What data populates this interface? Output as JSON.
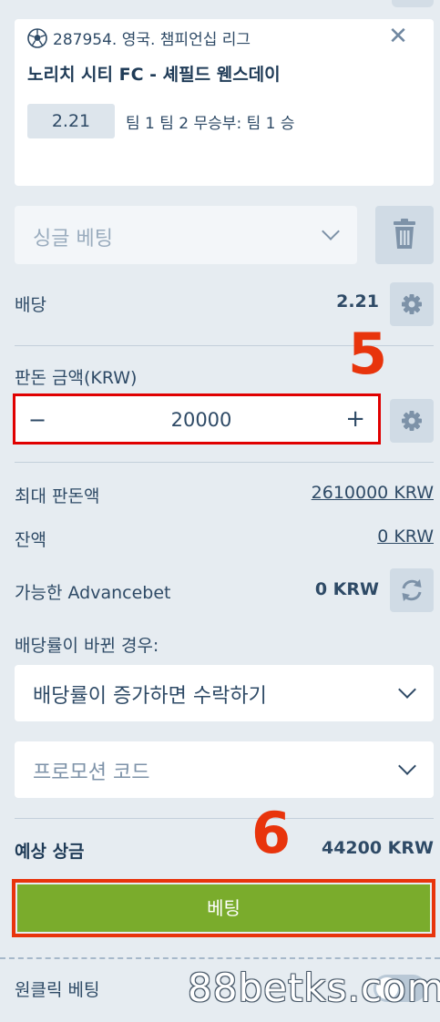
{
  "selection": {
    "league": "287954. 영국. 챔피언십 리그",
    "match": "노리치 시티 FC - 셰필드 웬스데이",
    "odd": "2.21",
    "outcome": "팀 1 팀 2 무승부: 팀 1 승",
    "icon": "soccer-ball-icon",
    "close_label": "✕"
  },
  "bet_type": {
    "label": "싱글 베팅"
  },
  "odds": {
    "label": "배당",
    "value": "2.21"
  },
  "stake": {
    "label": "판돈 금액(KRW)",
    "value": "20000",
    "minus": "−",
    "plus": "+"
  },
  "max_stake": {
    "label": "최대 판돈액",
    "value": "2610000 KRW"
  },
  "balance": {
    "label": "잔액",
    "value": "0 KRW"
  },
  "advancebet": {
    "label": "가능한 Advancebet",
    "value": "0 KRW"
  },
  "odds_change": {
    "label": "배당률이 바뀐 경우:",
    "selected": "배당률이 증가하면 수락하기"
  },
  "promo": {
    "placeholder": "프로모션 코드"
  },
  "potential_win": {
    "label": "예상 상금",
    "value": "44200 KRW"
  },
  "bet_button": {
    "label": "베팅"
  },
  "one_click": {
    "label": "원클릭 베팅"
  },
  "annotations": {
    "step5": "5",
    "step6": "6"
  },
  "watermark": "88betks.com",
  "colors": {
    "accent_green": "#7aac2c",
    "highlight_red": "#e8340c",
    "text_primary": "#2e4a66",
    "background": "#e6ecf1"
  }
}
